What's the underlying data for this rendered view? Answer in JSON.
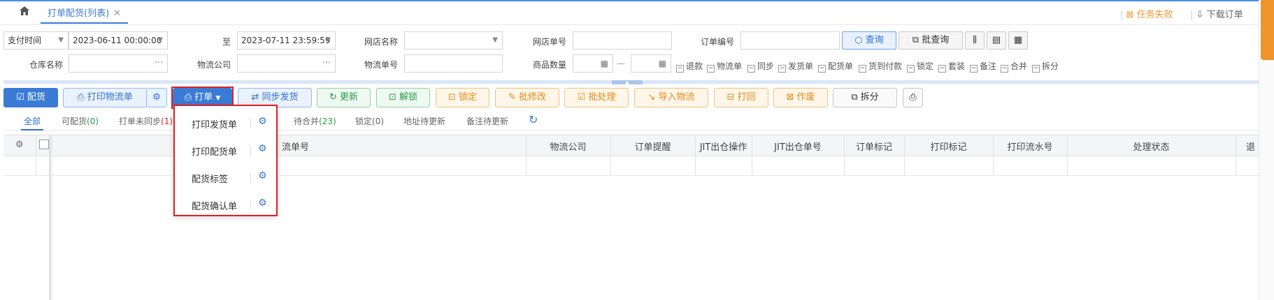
{
  "topbar": {
    "home_icon": "home-icon",
    "tab_label": "打单配货(列表)",
    "tab_close": "✕",
    "task_fail": "任务失败",
    "download_orders": "下载订单"
  },
  "form": {
    "time_type": "支付时间",
    "date_from": "2023-06-11 00:00:00",
    "to_label": "至",
    "date_to": "2023-07-11 23:59:59",
    "shop_name_label": "网店名称",
    "shop_order_label": "网店单号",
    "order_no_label": "订单编号",
    "query_button": "查询",
    "batch_query_button": "批查询",
    "warehouse_label": "仓库名称",
    "logistics_company_label": "物流公司",
    "logistics_no_label": "物流单号",
    "quantity_label": "商品数量",
    "range_sep": "—",
    "checkboxes": [
      "退款",
      "物流单",
      "同步",
      "发货单",
      "配货单",
      "货到付款",
      "锁定",
      "套装",
      "备注",
      "合并",
      "拆分"
    ]
  },
  "toolbar": {
    "allocate": "配货",
    "print_logistics": "打印物流单",
    "print_order": "打单",
    "sync_ship": "同步发货",
    "update": "更新",
    "unlock": "解锁",
    "lock": "锁定",
    "batch_modify": "批修改",
    "batch_process": "批处理",
    "import_logistics": "导入物流",
    "print_back": "打回",
    "void": "作废",
    "split": "拆分"
  },
  "filter_tabs": [
    {
      "label": "全部",
      "count": ""
    },
    {
      "label": "可配货",
      "count": "(0)"
    },
    {
      "label": "打单未同步",
      "count": "(1)"
    },
    {
      "label": "待合并",
      "count": "(23)"
    },
    {
      "label": "锁定",
      "count": "(0)"
    },
    {
      "label": "地址待更新",
      "count": ""
    },
    {
      "label": "备注待更新",
      "count": ""
    }
  ],
  "grid": {
    "columns": [
      "流单号",
      "物流公司",
      "订单提醒",
      "JIT出仓操作",
      "JIT出仓单号",
      "订单标记",
      "打印标记",
      "打印流水号",
      "处理状态",
      "退"
    ]
  },
  "dropdown": {
    "items": [
      "打印发货单",
      "打印配货单",
      "配货标签",
      "配货确认单"
    ]
  }
}
